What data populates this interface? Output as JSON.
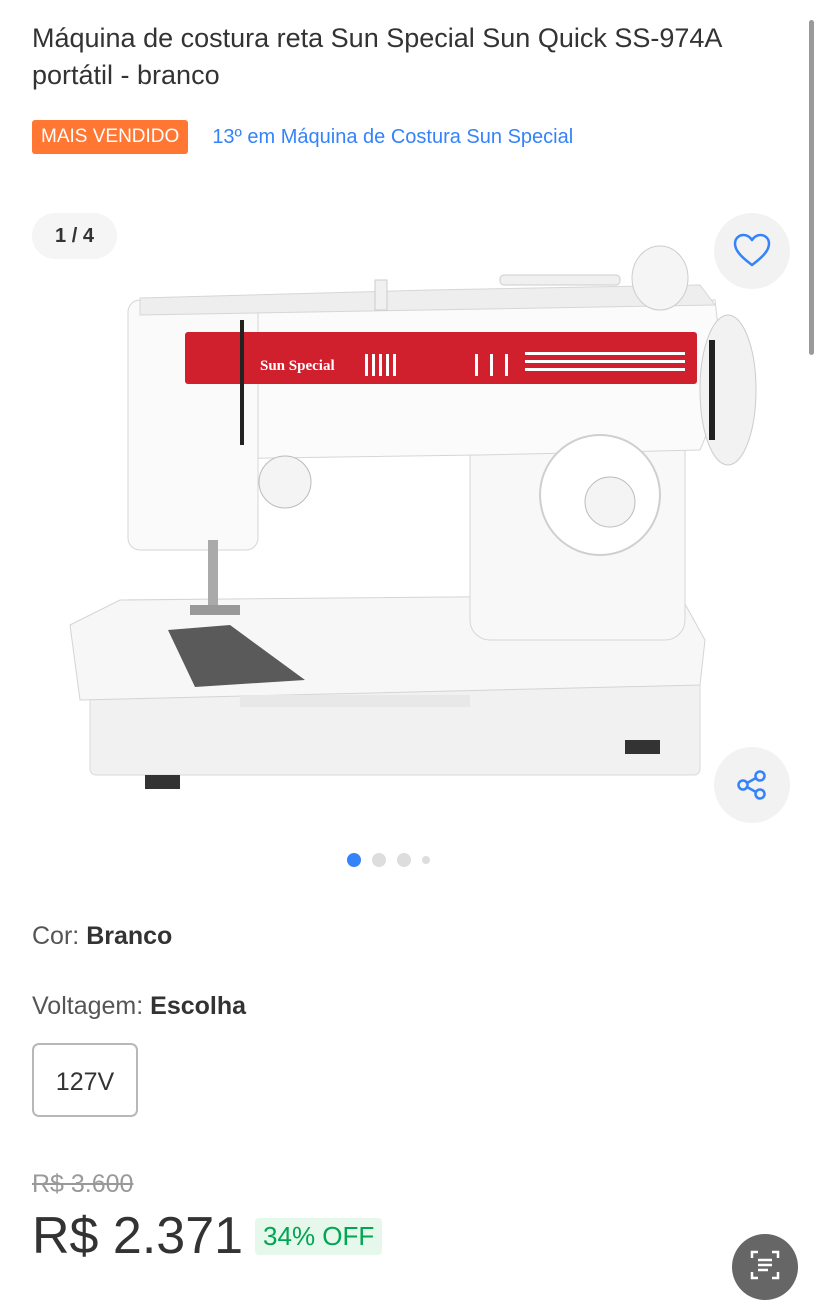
{
  "product": {
    "title": "Máquina de costura reta Sun Special Sun Quick SS-974A portátil - branco",
    "badge": "MAIS VENDIDO",
    "ranking": "13º em Máquina de Costura Sun Special"
  },
  "gallery": {
    "counter": "1 / 4",
    "brand_on_machine": "Sun Special",
    "dots": {
      "total": 4,
      "active": 1
    }
  },
  "attributes": {
    "color_label": "Cor: ",
    "color_value": "Branco",
    "voltage_label": "Voltagem: ",
    "voltage_value": "Escolha",
    "voltage_options": [
      "127V"
    ]
  },
  "pricing": {
    "old_price": "R$ 3.600",
    "price": "R$ 2.371",
    "discount": "34% OFF"
  },
  "icons": {
    "favorite": "heart-icon",
    "share": "share-icon",
    "fab": "document-scan-icon"
  },
  "colors": {
    "badge_bg": "#ff7733",
    "link": "#3483fa",
    "discount": "#00a650",
    "machine_accent": "#d0202e"
  }
}
